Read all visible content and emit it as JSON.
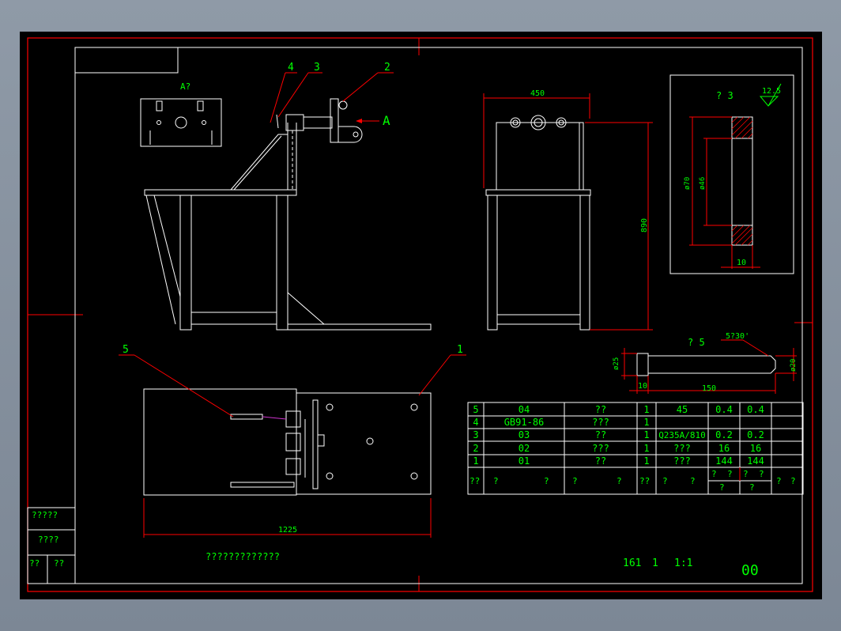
{
  "colors": {
    "background": "#000000",
    "frame": "#ff0000",
    "geometry": "#ffffff",
    "text": "#00ff00",
    "leader": "#ff0000",
    "accent": "#cc33cc"
  },
  "views": {
    "detail_a_label": "A?",
    "arrow_a_label": "A",
    "part_balloons": [
      "4",
      "3",
      "2",
      "5",
      "1"
    ],
    "section_3_title": "? 3",
    "section_5_title": "? 5",
    "roughness": "12.5"
  },
  "dimensions": {
    "front_width": "450",
    "front_height": "890",
    "ring_outer": "ø70",
    "ring_inner": "ø46",
    "ring_width": "10",
    "pin_dia": "ø25",
    "pin_end_dia": "ø20",
    "pin_head": "10",
    "pin_length": "150",
    "chamfer": "5?30'",
    "plan_length": "1225"
  },
  "parts_list": {
    "rows": [
      {
        "no": "5",
        "code": "04",
        "name": "??",
        "qty": "1",
        "material": "45",
        "w1": "0.4",
        "w2": "0.4"
      },
      {
        "no": "4",
        "code": "GB91-86",
        "name": "???",
        "qty": "1",
        "material": "",
        "w1": "",
        "w2": ""
      },
      {
        "no": "3",
        "code": "03",
        "name": "??",
        "qty": "1",
        "material": "Q235A/810",
        "w1": "0.2",
        "w2": "0.2"
      },
      {
        "no": "2",
        "code": "02",
        "name": "???",
        "qty": "1",
        "material": "???",
        "w1": "16",
        "w2": "16"
      },
      {
        "no": "1",
        "code": "01",
        "name": "??",
        "qty": "1",
        "material": "???",
        "w1": "144",
        "w2": "144"
      }
    ],
    "header": [
      "??",
      "?",
      "?",
      "?",
      "?",
      "??",
      "?",
      "?",
      "?",
      "?",
      "?",
      "?",
      "?",
      "?",
      "?",
      "?"
    ]
  },
  "title_block": {
    "sheet_info": "161",
    "count": "1",
    "scale": "1:1",
    "drawing_no": "00",
    "bottom_note": "?????????????"
  },
  "left_strip": {
    "label1": "?????",
    "label2": "????",
    "label3": "??",
    "label4": "??"
  }
}
